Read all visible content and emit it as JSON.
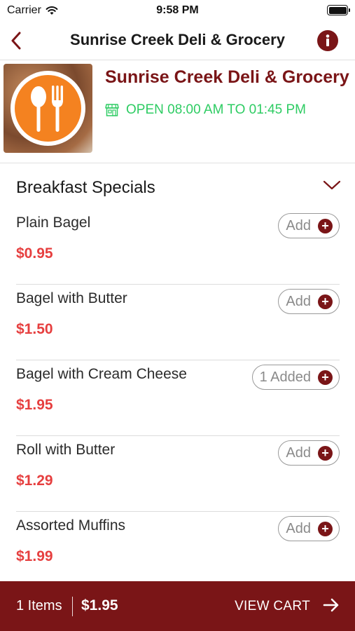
{
  "status_bar": {
    "carrier": "Carrier",
    "time": "9:58 PM"
  },
  "nav": {
    "title": "Sunrise Creek Deli & Grocery",
    "back_icon": "chevron-left-icon",
    "info_icon": "info-icon"
  },
  "store": {
    "name": "Sunrise Creek Deli & Grocery",
    "hours": "OPEN 08:00 AM TO 01:45 PM",
    "logo_icon": "spoon-fork-icon",
    "store_icon": "storefront-icon"
  },
  "section": {
    "title": "Breakfast Specials",
    "expanded": true
  },
  "items": [
    {
      "name": "Plain Bagel",
      "price": "$0.95",
      "button": "Add"
    },
    {
      "name": "Bagel with Butter",
      "price": "$1.50",
      "button": "Add"
    },
    {
      "name": "Bagel with Cream Cheese",
      "price": "$1.95",
      "button": "1 Added"
    },
    {
      "name": "Roll with Butter",
      "price": "$1.29",
      "button": "Add"
    },
    {
      "name": "Assorted Muffins",
      "price": "$1.99",
      "button": "Add"
    }
  ],
  "cart": {
    "count": "1 Items",
    "total": "$1.95",
    "view_label": "VIEW CART"
  },
  "colors": {
    "brand": "#7a1517",
    "open_green": "#2ecc63",
    "price_red": "#e63f3f",
    "logo_orange": "#f48220"
  }
}
